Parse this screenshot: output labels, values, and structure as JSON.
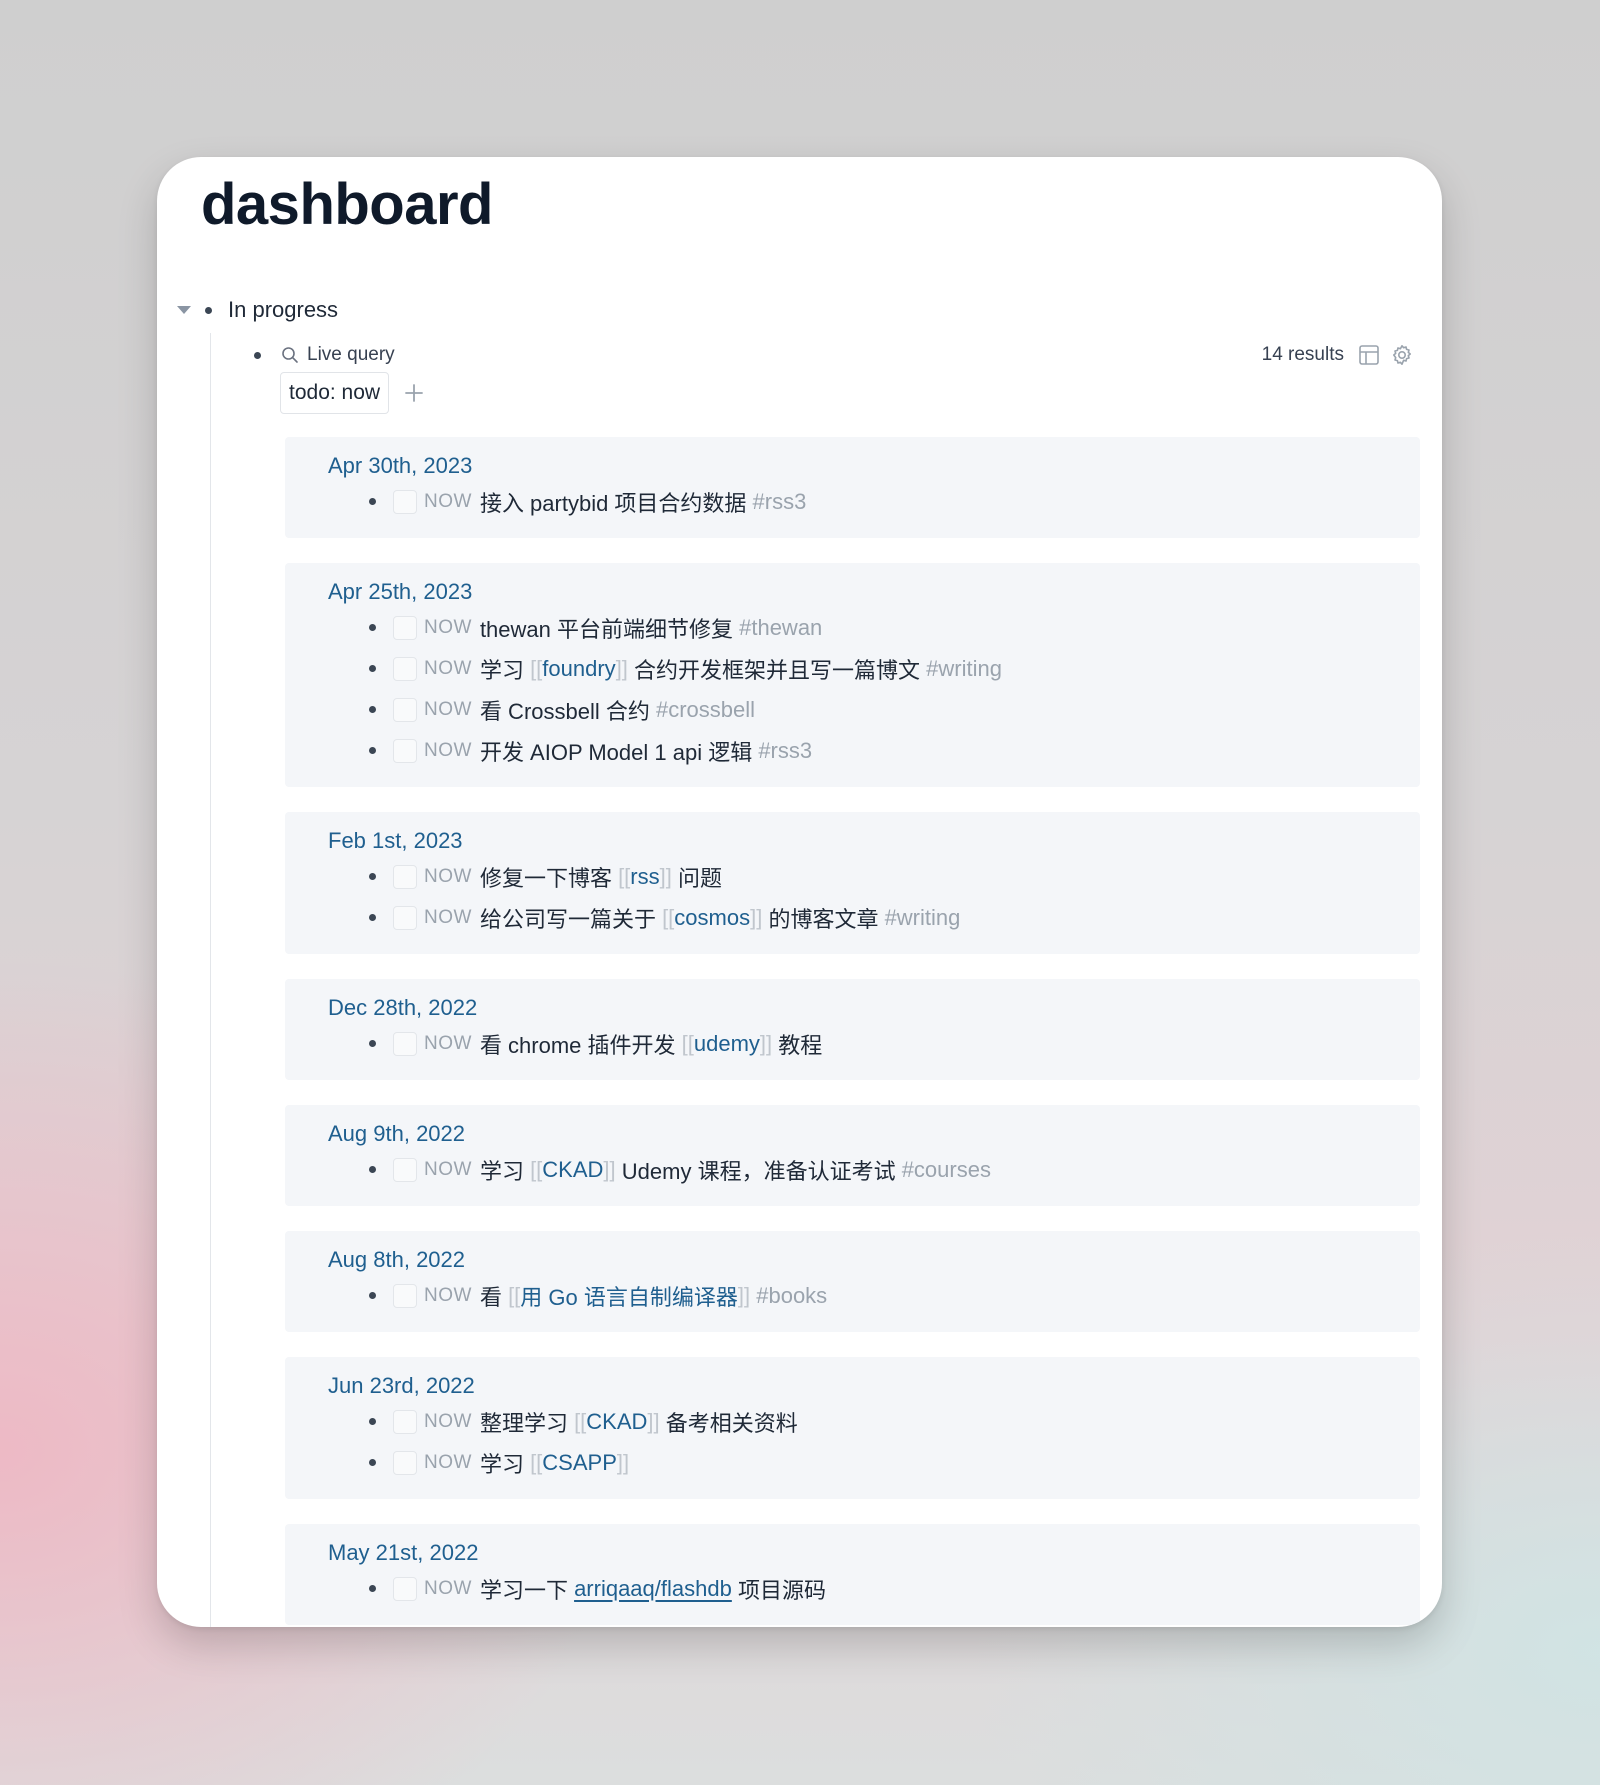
{
  "page": {
    "title": "dashboard"
  },
  "section": {
    "label": "In progress"
  },
  "query": {
    "label": "Live query",
    "results": "14 results",
    "filter": "todo: now"
  },
  "groups": [
    {
      "date": "Apr 30th, 2023",
      "tasks": [
        {
          "marker": "NOW",
          "parts": [
            {
              "t": "txt",
              "v": "接入 partybid 项目合约数据 "
            },
            {
              "t": "tag",
              "v": "#rss3"
            }
          ]
        }
      ]
    },
    {
      "date": "Apr 25th, 2023",
      "tasks": [
        {
          "marker": "NOW",
          "parts": [
            {
              "t": "txt",
              "v": "thewan 平台前端细节修复 "
            },
            {
              "t": "tag",
              "v": "#thewan"
            }
          ]
        },
        {
          "marker": "NOW",
          "parts": [
            {
              "t": "txt",
              "v": "学习 "
            },
            {
              "t": "open",
              "v": "[["
            },
            {
              "t": "link",
              "v": "foundry"
            },
            {
              "t": "close",
              "v": "]]"
            },
            {
              "t": "txt",
              "v": " 合约开发框架并且写一篇博文 "
            },
            {
              "t": "tag",
              "v": "#writing"
            }
          ]
        },
        {
          "marker": "NOW",
          "parts": [
            {
              "t": "txt",
              "v": "看 Crossbell 合约 "
            },
            {
              "t": "tag",
              "v": "#crossbell"
            }
          ]
        },
        {
          "marker": "NOW",
          "parts": [
            {
              "t": "txt",
              "v": "开发 AIOP Model 1 api 逻辑 "
            },
            {
              "t": "tag",
              "v": "#rss3"
            }
          ]
        }
      ]
    },
    {
      "date": "Feb 1st, 2023",
      "tasks": [
        {
          "marker": "NOW",
          "parts": [
            {
              "t": "txt",
              "v": "修复一下博客 "
            },
            {
              "t": "open",
              "v": "[["
            },
            {
              "t": "link",
              "v": "rss"
            },
            {
              "t": "close",
              "v": "]]"
            },
            {
              "t": "txt",
              "v": " 问题"
            }
          ]
        },
        {
          "marker": "NOW",
          "parts": [
            {
              "t": "txt",
              "v": "给公司写一篇关于 "
            },
            {
              "t": "open",
              "v": "[["
            },
            {
              "t": "link",
              "v": "cosmos"
            },
            {
              "t": "close",
              "v": "]]"
            },
            {
              "t": "txt",
              "v": " 的博客文章 "
            },
            {
              "t": "tag",
              "v": "#writing"
            }
          ]
        }
      ]
    },
    {
      "date": "Dec 28th, 2022",
      "tasks": [
        {
          "marker": "NOW",
          "parts": [
            {
              "t": "txt",
              "v": "看 chrome 插件开发 "
            },
            {
              "t": "open",
              "v": "[["
            },
            {
              "t": "link",
              "v": "udemy"
            },
            {
              "t": "close",
              "v": "]]"
            },
            {
              "t": "txt",
              "v": " 教程"
            }
          ]
        }
      ]
    },
    {
      "date": "Aug 9th, 2022",
      "tasks": [
        {
          "marker": "NOW",
          "parts": [
            {
              "t": "txt",
              "v": "学习 "
            },
            {
              "t": "open",
              "v": "[["
            },
            {
              "t": "link",
              "v": "CKAD"
            },
            {
              "t": "close",
              "v": "]]"
            },
            {
              "t": "txt",
              "v": " Udemy 课程，准备认证考试 "
            },
            {
              "t": "tag",
              "v": "#courses"
            }
          ]
        }
      ]
    },
    {
      "date": "Aug 8th, 2022",
      "tasks": [
        {
          "marker": "NOW",
          "parts": [
            {
              "t": "txt",
              "v": "看 "
            },
            {
              "t": "open",
              "v": "[["
            },
            {
              "t": "link",
              "v": "用 Go 语言自制编译器"
            },
            {
              "t": "close",
              "v": "]]"
            },
            {
              "t": "txt",
              "v": " "
            },
            {
              "t": "tag",
              "v": "#books"
            }
          ]
        }
      ]
    },
    {
      "date": "Jun 23rd, 2022",
      "tasks": [
        {
          "marker": "NOW",
          "parts": [
            {
              "t": "txt",
              "v": "整理学习 "
            },
            {
              "t": "open",
              "v": "[["
            },
            {
              "t": "link",
              "v": "CKAD"
            },
            {
              "t": "close",
              "v": "]]"
            },
            {
              "t": "txt",
              "v": " 备考相关资料"
            }
          ]
        },
        {
          "marker": "NOW",
          "parts": [
            {
              "t": "txt",
              "v": "学习 "
            },
            {
              "t": "open",
              "v": "[["
            },
            {
              "t": "link",
              "v": "CSAPP"
            },
            {
              "t": "close",
              "v": "]]"
            }
          ]
        }
      ]
    },
    {
      "date": "May 21st, 2022",
      "tasks": [
        {
          "marker": "NOW",
          "parts": [
            {
              "t": "txt",
              "v": "学习一下 "
            },
            {
              "t": "ext",
              "v": "arriqaaq/flashdb"
            },
            {
              "t": "txt",
              "v": " 项目源码"
            }
          ]
        }
      ]
    }
  ],
  "icons": {
    "caret": "caret-down-icon",
    "bullet": "bullet-icon",
    "search": "search-icon",
    "table": "table-view-icon",
    "settings": "gear-icon",
    "add": "plus-icon",
    "checkbox": "checkbox-icon"
  },
  "colors": {
    "link": "#1f5f8f",
    "tag": "#9aa3ad",
    "bracket": "#c0c6cd",
    "group_bg": "#f4f6f9",
    "text": "#1f2937"
  }
}
